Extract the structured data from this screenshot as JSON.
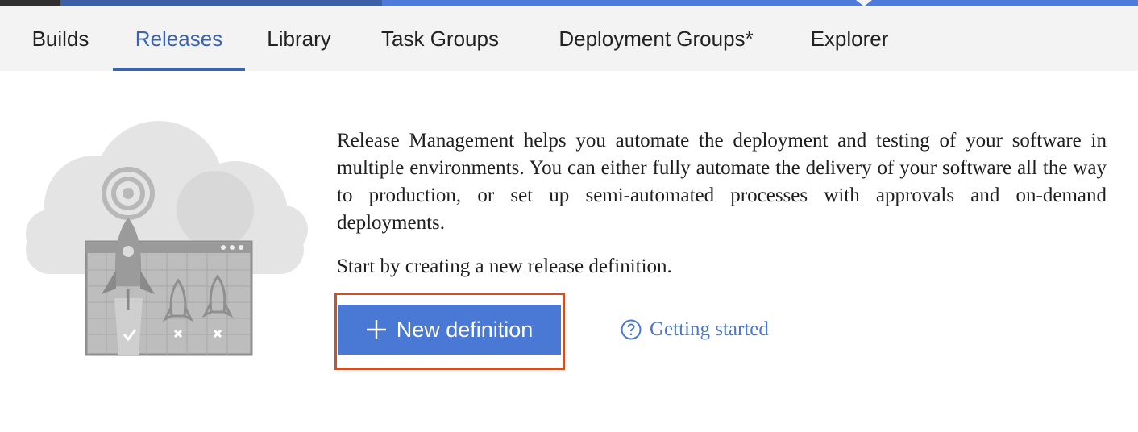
{
  "tabs": [
    {
      "label": "Builds",
      "active": false
    },
    {
      "label": "Releases",
      "active": true
    },
    {
      "label": "Library",
      "active": false
    },
    {
      "label": "Task Groups",
      "active": false
    },
    {
      "label": "Deployment Groups*",
      "active": false
    },
    {
      "label": "Explorer",
      "active": false
    }
  ],
  "empty_state": {
    "illustration_icon": "rocket-launch-illustration",
    "description": "Release Management helps you automate the deployment and testing of your software in multiple environments. You can either fully automate the delivery of your software all the way to production, or set up semi-automated processes with approvals and on-demand deployments.",
    "prompt": "Start by creating a new release definition.",
    "new_definition_label": "New definition",
    "new_definition_icon": "plus-icon",
    "getting_started_label": "Getting started",
    "getting_started_icon": "help-circle-icon"
  },
  "colors": {
    "accent": "#4a78d5",
    "active_tab": "#3b63ad",
    "highlight_border": "#c7532a",
    "tab_bar_bg": "#f3f3f3"
  }
}
